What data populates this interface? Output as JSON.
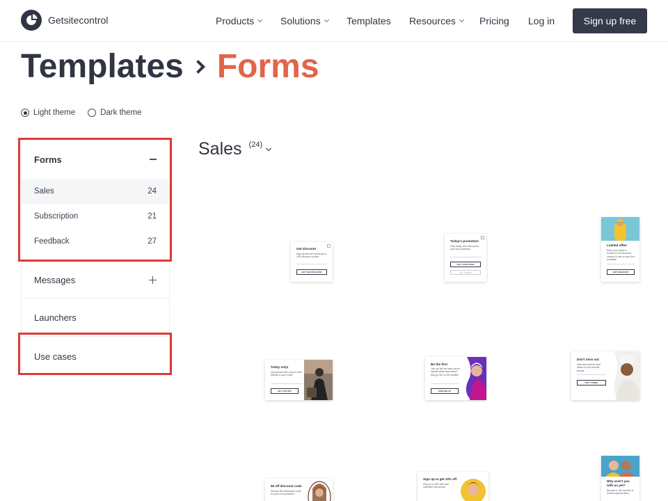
{
  "header": {
    "brand": "Getsitecontrol",
    "nav": [
      {
        "label": "Products",
        "dropdown": true
      },
      {
        "label": "Solutions",
        "dropdown": true
      },
      {
        "label": "Templates",
        "dropdown": false
      },
      {
        "label": "Resources",
        "dropdown": true
      },
      {
        "label": "Pricing",
        "dropdown": false
      },
      {
        "label": "Log in",
        "dropdown": false
      }
    ],
    "signup_label": "Sign up free"
  },
  "page": {
    "crumb_root": "Templates",
    "crumb_current": "Forms",
    "accent_color": "#e2644a",
    "highlight_color": "#dc3b36"
  },
  "themes": [
    {
      "label": "Light theme",
      "selected": true
    },
    {
      "label": "Dark theme",
      "selected": false
    }
  ],
  "sidebar": {
    "forms": {
      "label": "Forms",
      "expanded": true,
      "items": [
        {
          "label": "Sales",
          "count": "24",
          "active": true
        },
        {
          "label": "Subscription",
          "count": "21",
          "active": false
        },
        {
          "label": "Feedback",
          "count": "27",
          "active": false
        }
      ]
    },
    "messages": {
      "label": "Messages",
      "expanded": false
    },
    "launchers": {
      "label": "Launchers"
    },
    "use_cases": {
      "label": "Use cases"
    }
  },
  "section": {
    "title": "Sales",
    "count": "(24)"
  },
  "templates": [
    {
      "title": "Get discount",
      "text": "Sign up and we'll send you a 10% discount coupon",
      "button": "GET THE DISCOUNT",
      "secondary": ""
    },
    {
      "title": "Today's promotion",
      "text": "Only today 10% discount to your next purchase",
      "button": "GET YOUR CODE",
      "secondary": "NO, THANKS"
    },
    {
      "title": "Limited offer!",
      "text": "Enter your email to receive a 10% discount coupon to use on your first purchase",
      "button": "GET DISCOUNT",
      "secondary": ""
    },
    {
      "title": "Today only!",
      "text": "Get special offer coupon code directly to your email",
      "button": "GET 10% OFF",
      "secondary": ""
    },
    {
      "title": "Be the first",
      "text": "Join our list and learn about special deals days before they go live on the website",
      "button": "SIGN ME UP",
      "secondary": ""
    },
    {
      "title": "Don't miss out",
      "text": "Hear about all the best deals on your favorite brands",
      "button": "STAY TUNED",
      "secondary": ""
    },
    {
      "title": "$5 off discount code",
      "text": "Receive $5 off discount code for your next purchase",
      "button": "",
      "secondary": ""
    },
    {
      "title": "Sign up to get 10% off",
      "text": "Plus up to 40% with new collection first access",
      "button": "",
      "secondary": ""
    },
    {
      "title": "Why aren't you with us yet?",
      "text": "Become a VIP member to receive special offers",
      "button": "",
      "secondary": ""
    }
  ]
}
